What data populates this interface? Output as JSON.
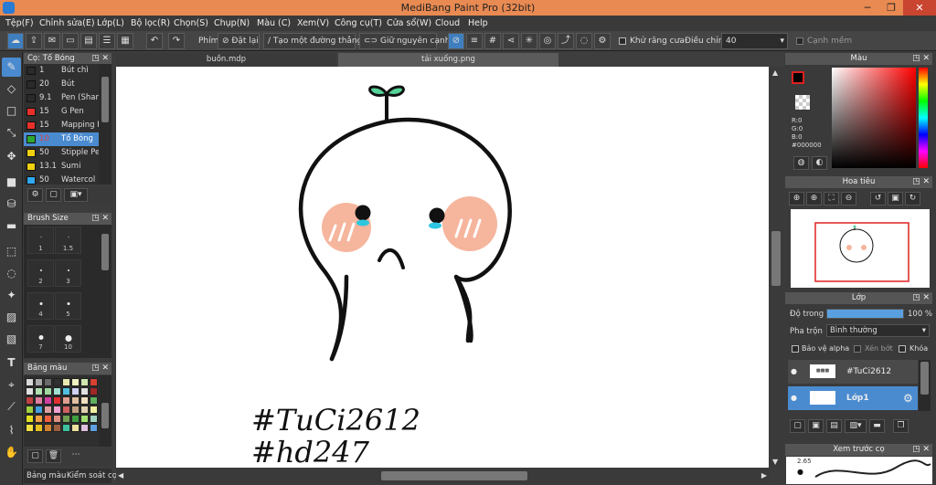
{
  "window": {
    "title": "MediBang Paint Pro (32bit)",
    "minimize": "─",
    "maximize": "❐",
    "close": "✕"
  },
  "menu": [
    "Tệp(F)",
    "Chỉnh sửa(E)",
    "Lớp(L)",
    "Bộ lọc(R)",
    "Chọn(S)",
    "Chụp(N)",
    "Màu (C)",
    "Xem(V)",
    "Công cụ(T)",
    "Cửa sổ(W)",
    "Cloud",
    "Help"
  ],
  "toolbar": {
    "phim_label": "Phím",
    "reset_label": "Đặt lại",
    "straight_line_label": "Tạo một đường thẳng",
    "keep_edge_label": "Giữ nguyên cạnh",
    "antialias_label": "Khử răng cưa",
    "adjust_label": "Điều chỉnh",
    "adjust_value": "40",
    "smooth_label": "Cạnh mềm"
  },
  "brush_panel": {
    "title": "Cọ: Tố Bóng",
    "brushes": [
      {
        "size": "1",
        "name": "Bút chì",
        "color": "#2a2a2a"
      },
      {
        "size": "20",
        "name": "Bút",
        "color": "#2a2a2a"
      },
      {
        "size": "9.1",
        "name": "Pen (Shar",
        "color": "#2a2a2a"
      },
      {
        "size": "15",
        "name": "G Pen",
        "color": "#e8302a"
      },
      {
        "size": "15",
        "name": "Mapping F",
        "color": "#e8302a"
      },
      {
        "size": "10",
        "name": "Tố Bóng",
        "color": "#2fa834"
      },
      {
        "size": "50",
        "name": "Stipple Pe",
        "color": "#f0d010"
      },
      {
        "size": "13.1",
        "name": "Sumi",
        "color": "#f0d010"
      },
      {
        "size": "50",
        "name": "Watercol",
        "color": "#2fa8f0"
      }
    ],
    "selected_index": 5
  },
  "brush_size": {
    "title": "Brush Size",
    "sizes": [
      "1",
      "1.5",
      "2",
      "3",
      "4",
      "5",
      "7",
      "10"
    ]
  },
  "palette": {
    "title": "Bảng màu",
    "colors": [
      "#d8d8d8",
      "#a8a8a8",
      "#6a6a6a",
      "#303030",
      "#e8e8b0",
      "#f0f0c0",
      "#d0e8b0",
      "#d84030",
      "#e0e0e0",
      "#b0e0b0",
      "#a0d8a0",
      "#a0e0d0",
      "#50c0e0",
      "#d0d0f0",
      "#e0e0e0",
      "#a02828",
      "#c04040",
      "#e080a0",
      "#d040a0",
      "#e03030",
      "#e0a090",
      "#e0c0a0",
      "#f0e0c0",
      "#60b060",
      "#a0d040",
      "#40a0e0",
      "#e0a0a0",
      "#f0a0d0",
      "#d06060",
      "#c0a080",
      "#e0d0b0",
      "#f0f0a0",
      "#e0e020",
      "#f0a040",
      "#f06040",
      "#e09080",
      "#70a050",
      "#40a040",
      "#a0e070",
      "#a0d0c0",
      "#f0e040",
      "#e8c020",
      "#d08030",
      "#a06040",
      "#40c0a0",
      "#f0e0a0",
      "#e0c0e0",
      "#60a0e0"
    ]
  },
  "left_bottom_tabs": [
    "Bảng màu",
    "Kiểm soát cọ"
  ],
  "doc_tabs": [
    "buồn.mdp",
    "tải xuống.png"
  ],
  "color_panel": {
    "title": "Màu",
    "r": "R:0",
    "g": "G:0",
    "b": "B:0",
    "hex": "#000000"
  },
  "navigator": {
    "title": "Hoa tiêu"
  },
  "layers": {
    "title": "Lớp",
    "opacity_label": "Độ trong",
    "opacity_value": "100 %",
    "opacity_fraction": 1.0,
    "blend_label": "Pha trộn",
    "blend_value": "Bình thường",
    "protect_alpha": "Bảo vệ alpha",
    "clipping": "Xén bớt",
    "lock": "Khóa",
    "items": [
      {
        "name": "#TuCi2612",
        "selected": false
      },
      {
        "name": "Lớp1",
        "selected": true
      }
    ]
  },
  "brush_preview": {
    "title": "Xem trước cọ",
    "size_label": "2.65"
  },
  "canvas_text": {
    "line1": "#TuCi2612",
    "line2": "#hd247"
  }
}
